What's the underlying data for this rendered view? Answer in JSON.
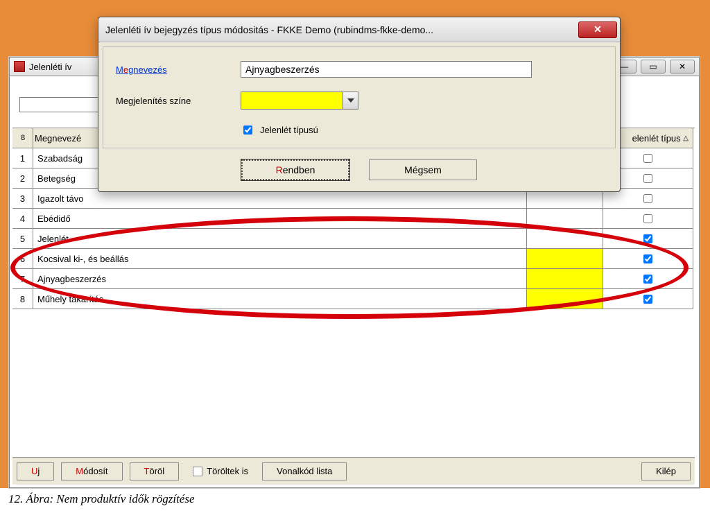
{
  "main": {
    "title": "Jelenléti ív",
    "filter_value": "",
    "headers": {
      "index": "8",
      "name": "Megnevezé",
      "color": "",
      "check": "elenlét típus"
    },
    "rows": [
      {
        "idx": "1",
        "name": "Szabadság",
        "color": "",
        "checked": false
      },
      {
        "idx": "2",
        "name": "Betegség",
        "color": "",
        "checked": false
      },
      {
        "idx": "3",
        "name": "Igazolt távo",
        "color": "",
        "checked": false
      },
      {
        "idx": "4",
        "name": "Ebédidő",
        "color": "",
        "checked": false
      },
      {
        "idx": "5",
        "name": "Jelenlét",
        "color": "",
        "checked": true
      },
      {
        "idx": "6",
        "name": "Kocsival ki-, és beállás",
        "color": "#ffff00",
        "checked": true
      },
      {
        "idx": "7",
        "name": "Ajnyagbeszerzés",
        "color": "#ffff00",
        "checked": true
      },
      {
        "idx": "8",
        "name": "Műhely takarítás",
        "color": "#ffff00",
        "checked": true
      }
    ],
    "buttons": {
      "new_pre": "U",
      "new_post": "j",
      "edit_pre": "M",
      "edit_post": "ódosít",
      "del_pre": "T",
      "del_post": "öröl",
      "deleted_also": "Töröltek is",
      "barcode": "Vonalkód lista",
      "exit": "Kilép"
    }
  },
  "dialog": {
    "title": "Jelenléti ív bejegyzés típus módositás - FKKE Demo (rubindms-fkke-demo...",
    "fields": {
      "name_label_pre": "M",
      "name_label_acc": "e",
      "name_label_post": "gnevezés",
      "name_value": "Ajnyagbeszerzés",
      "color_label": "Megjelenítés színe",
      "color_value": "#ffff00",
      "presence_label": "Jelenlét típusú",
      "presence_checked": true
    },
    "buttons": {
      "ok_pre": "R",
      "ok_post": "endben",
      "cancel": "Mégsem"
    }
  },
  "caption": "12. Ábra: Nem produktív idők rögzítése"
}
